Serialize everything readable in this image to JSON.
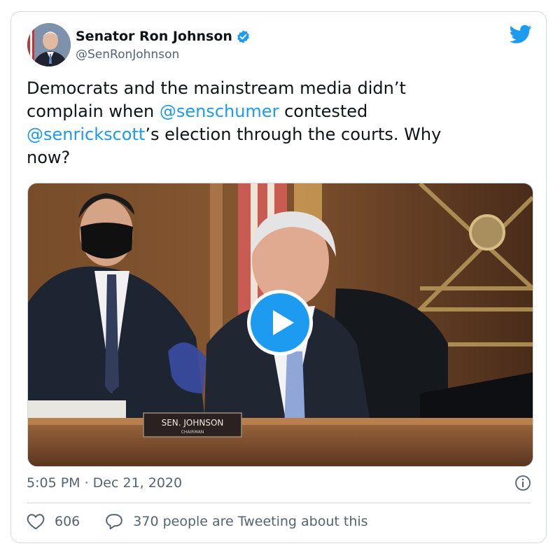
{
  "author": {
    "name": "Senator Ron Johnson",
    "handle": "@SenRonJohnson",
    "verified": true
  },
  "tweet": {
    "text_parts": [
      {
        "type": "text",
        "value": "Democrats and the mainstream media didn’t\ncomplain when "
      },
      {
        "type": "mention",
        "value": "@senschumer"
      },
      {
        "type": "text",
        "value": " contested\n"
      },
      {
        "type": "mention",
        "value": "@senrickscott"
      },
      {
        "type": "text",
        "value": "’s election through the courts. Why\nnow?"
      }
    ],
    "timestamp": "5:05 PM · Dec 21, 2020"
  },
  "media": {
    "type": "video",
    "nameplate_name": "SEN. JOHNSON",
    "nameplate_title": "CHAIRMAN"
  },
  "engagement": {
    "likes": "606",
    "conversation": "370 people are Tweeting about this"
  },
  "colors": {
    "accent": "#1d9bf0",
    "text": "#0f1419",
    "muted": "#536471",
    "border": "#cfd9de"
  },
  "icons": [
    "verified-badge-icon",
    "twitter-bird-icon",
    "play-icon",
    "info-icon",
    "heart-icon",
    "speech-bubble-icon"
  ]
}
